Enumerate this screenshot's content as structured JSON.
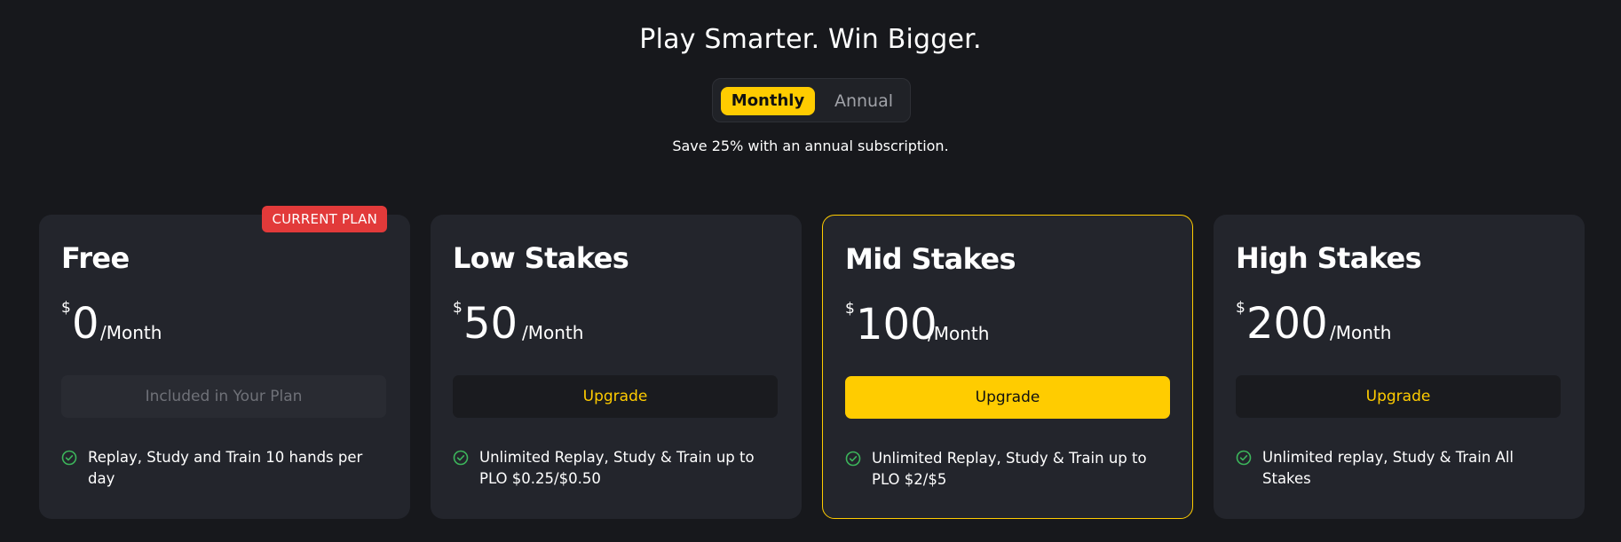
{
  "header": {
    "title": "Play Smarter. Win Bigger.",
    "save_note": "Save 25% with an annual subscription."
  },
  "billing_toggle": {
    "monthly_label": "Monthly",
    "annual_label": "Annual",
    "selected": "Monthly"
  },
  "plans": [
    {
      "name": "Free",
      "currency": "$",
      "amount": "0",
      "period": "/Month",
      "badge": "CURRENT PLAN",
      "cta": "Included in Your Plan",
      "feature": "Replay, Study and Train 10 hands per day"
    },
    {
      "name": "Low Stakes",
      "currency": "$",
      "amount": "50",
      "period": "/Month",
      "cta": "Upgrade",
      "feature": "Unlimited Replay, Study & Train up to PLO $0.25/$0.50"
    },
    {
      "name": "Mid Stakes",
      "currency": "$",
      "amount": "100",
      "period": "/Month",
      "cta": "Upgrade",
      "feature": "Unlimited Replay, Study & Train up to PLO $2/$5"
    },
    {
      "name": "High Stakes",
      "currency": "$",
      "amount": "200",
      "period": "/Month",
      "cta": "Upgrade",
      "feature": "Unlimited replay, Study & Train All Stakes"
    }
  ],
  "colors": {
    "background": "#17181c",
    "card": "#23252c",
    "accent": "#ffcc00",
    "badge": "#e23a3a",
    "check": "#3cb55b"
  },
  "icons": {
    "feature_check": "check-circle-icon"
  }
}
